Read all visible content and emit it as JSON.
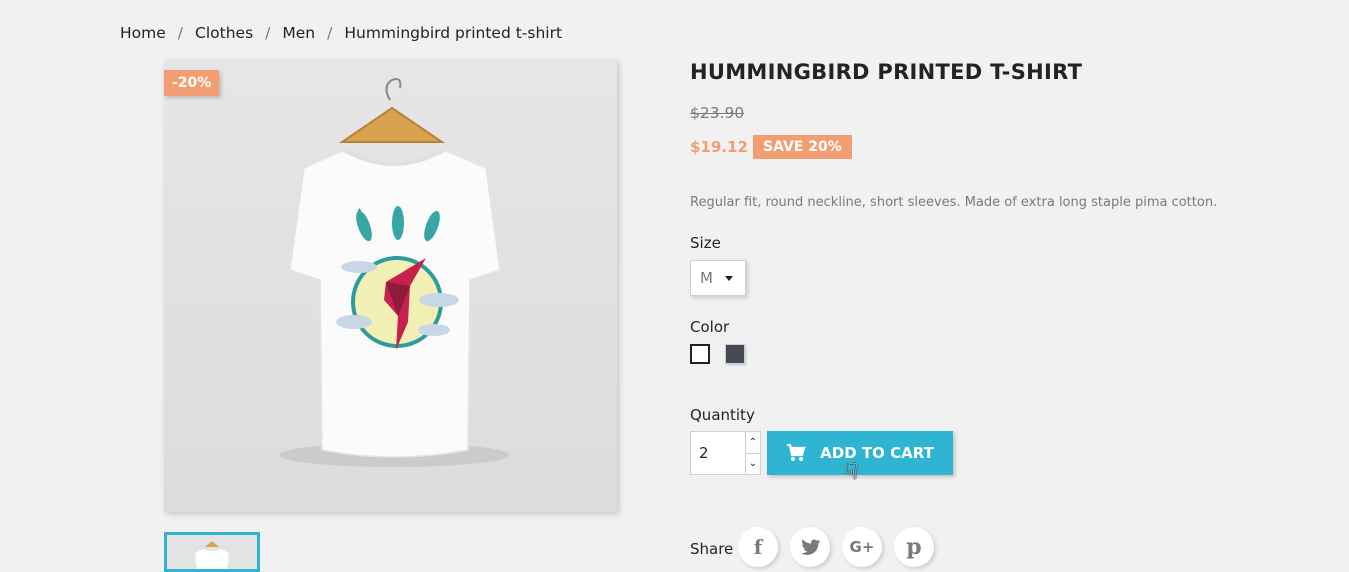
{
  "breadcrumb": {
    "items": [
      "Home",
      "Clothes",
      "Men",
      "Hummingbird printed t-shirt"
    ],
    "separator": "/"
  },
  "product": {
    "discount_flag": "-20%",
    "title": "Hummingbird printed t-shirt",
    "regular_price": "$23.90",
    "price": "$19.12",
    "save_label": "SAVE 20%",
    "description": "Regular fit, round neckline, short sleeves. Made of extra long staple pima cotton."
  },
  "options": {
    "size_label": "Size",
    "size_value": "M",
    "color_label": "Color",
    "colors": [
      "#ffffff",
      "#434a54"
    ]
  },
  "cart": {
    "quantity_label": "Quantity",
    "quantity_value": "2",
    "add_to_cart_label": "ADD TO CART"
  },
  "share": {
    "label": "Share",
    "networks": [
      "facebook",
      "twitter",
      "google-plus",
      "pinterest"
    ]
  },
  "colors": {
    "accent": "#2fb5d2",
    "discount": "#f39d72"
  }
}
